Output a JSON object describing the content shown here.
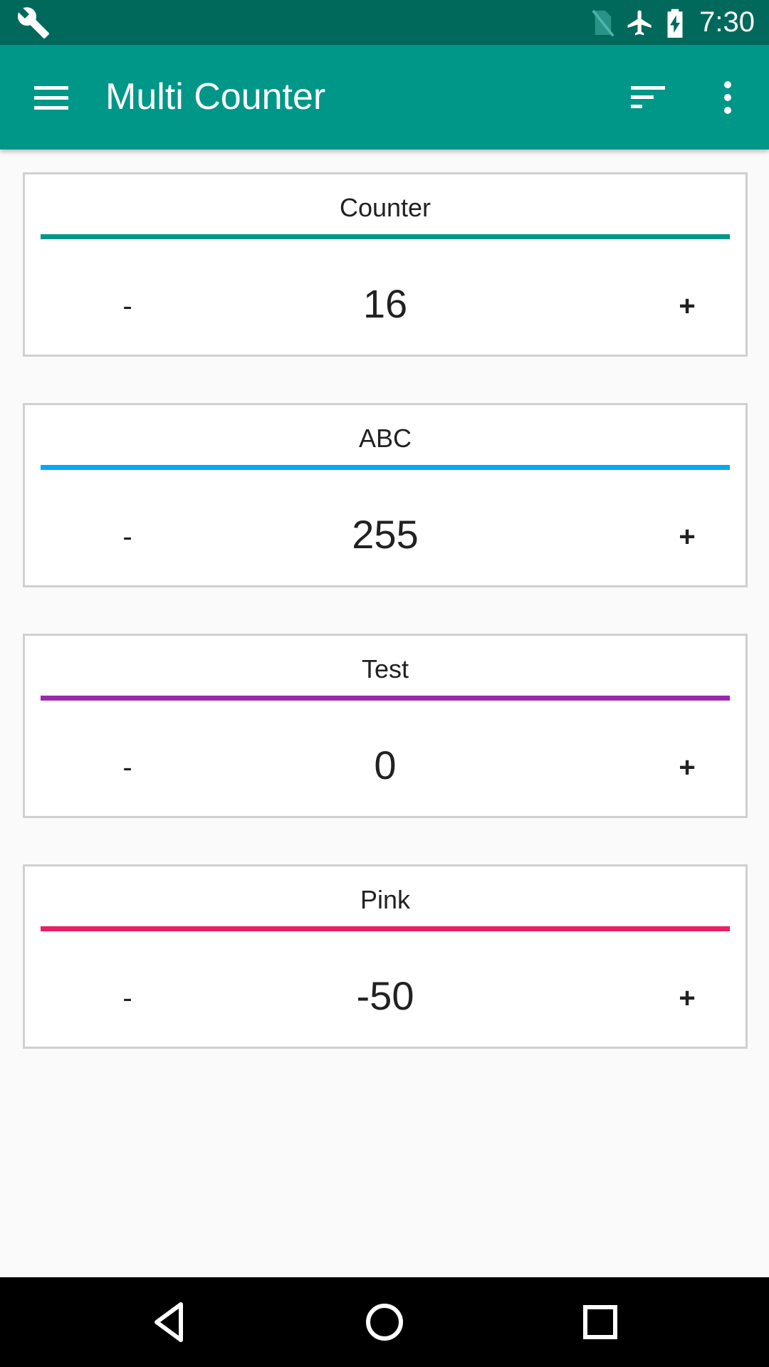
{
  "status_bar": {
    "time": "7:30",
    "icons": [
      "wrench-icon",
      "no-sim-icon",
      "airplane-icon",
      "battery-charging-icon"
    ]
  },
  "app_bar": {
    "title": "Multi Counter",
    "icons": [
      "menu-icon",
      "sort-icon",
      "more-vert-icon"
    ],
    "color": "#009688",
    "status_color": "#00695c"
  },
  "counters": [
    {
      "name": "Counter",
      "value": "16",
      "color": "#009688",
      "minus": "-",
      "plus": "+"
    },
    {
      "name": "ABC",
      "value": "255",
      "color": "#03a9f4",
      "minus": "-",
      "plus": "+"
    },
    {
      "name": "Test",
      "value": "0",
      "color": "#9c27b0",
      "minus": "-",
      "plus": "+"
    },
    {
      "name": "Pink",
      "value": "-50",
      "color": "#e91e63",
      "minus": "-",
      "plus": "+"
    }
  ],
  "nav_bar": {
    "icons": [
      "back-icon",
      "home-icon",
      "recents-icon"
    ]
  }
}
